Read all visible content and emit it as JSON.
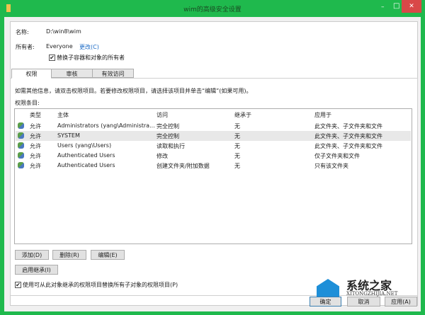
{
  "window": {
    "title": "wim的高级安全设置",
    "minimize": "–",
    "maximize": "□",
    "close": "✕",
    "accent": "#1fb94d",
    "close_color": "#d94848"
  },
  "name_label": "名称:",
  "name_value": "D:\\win8\\wim",
  "owner_label": "所有者:",
  "owner_value": "Everyone",
  "owner_change": "更改(C)",
  "replace_owner": {
    "label": "替换子容器和对象的所有者",
    "checked": true
  },
  "tabs": [
    {
      "label": "权限",
      "active": true
    },
    {
      "label": "审核"
    },
    {
      "label": "有效访问"
    }
  ],
  "info_text": "如需其他信息，请双击权限项目。若要修改权限项目，请选择该项目并单击“编辑”(如果可用)。",
  "entries_label": "权限条目:",
  "columns": [
    "类型",
    "主体",
    "访问",
    "继承于",
    "应用于"
  ],
  "rows": [
    {
      "type": "允许",
      "principal": "Administrators (yang\\Administra...",
      "access": "完全控制",
      "inherit": "无",
      "apply": "此文件夹、子文件夹和文件"
    },
    {
      "type": "允许",
      "principal": "SYSTEM",
      "access": "完全控制",
      "inherit": "无",
      "apply": "此文件夹、子文件夹和文件",
      "selected": true
    },
    {
      "type": "允许",
      "principal": "Users (yang\\Users)",
      "access": "读取和执行",
      "inherit": "无",
      "apply": "此文件夹、子文件夹和文件"
    },
    {
      "type": "允许",
      "principal": "Authenticated Users",
      "access": "修改",
      "inherit": "无",
      "apply": "仅子文件夹和文件"
    },
    {
      "type": "允许",
      "principal": "Authenticated Users",
      "access": "创建文件夹/附加数据",
      "inherit": "无",
      "apply": "只有该文件夹"
    }
  ],
  "buttons": {
    "add": "添加(D)",
    "remove": "删除(R)",
    "edit": "编辑(E)",
    "enable_inherit": "启用继承(I)",
    "ok": "确定",
    "cancel": "取消",
    "apply": "应用(A)"
  },
  "replace_child": {
    "label": "使用可从此对象继承的权限项目替换所有子对象的权限项目(P)",
    "checked": true
  },
  "watermark": {
    "name": "系统之家",
    "url": "XITONGZHIJIA.NET"
  }
}
